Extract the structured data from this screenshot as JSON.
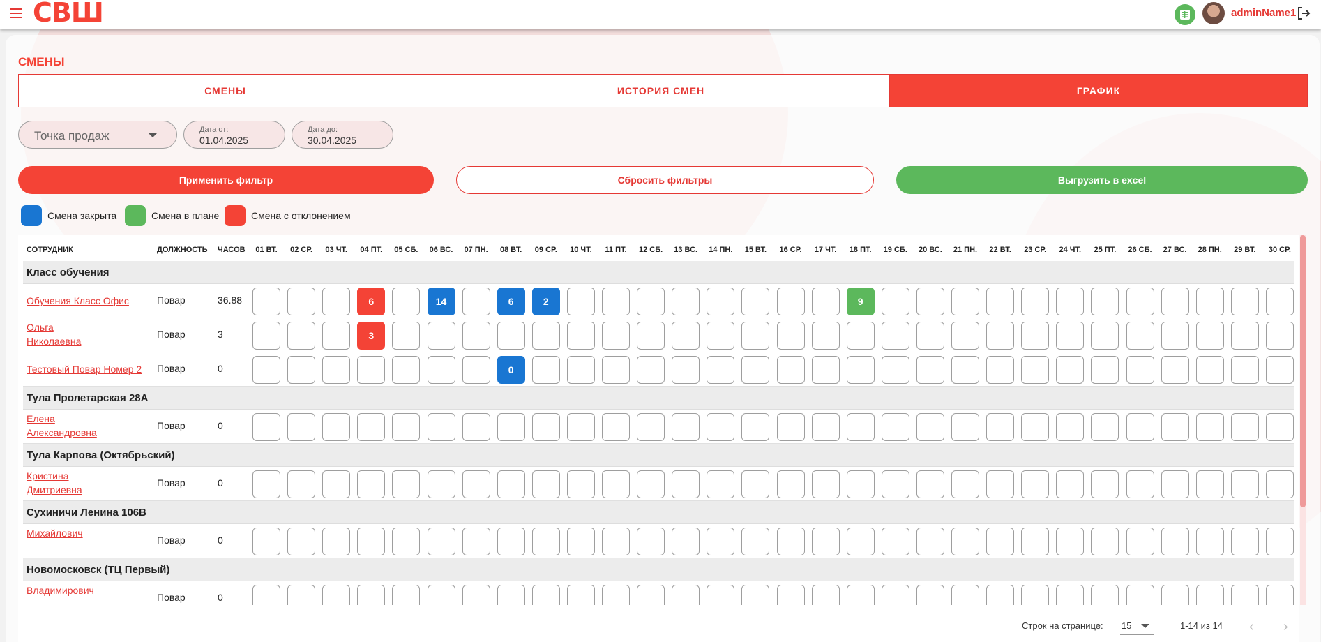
{
  "header": {
    "logo": "СВШ",
    "username": "adminName1",
    "icons": [
      "menu-icon",
      "excel-icon",
      "avatar",
      "logout-icon"
    ]
  },
  "page": {
    "title": "СМЕНЫ",
    "tabs": [
      {
        "label": "СМЕНЫ",
        "active": false
      },
      {
        "label": "ИСТОРИЯ СМЕН",
        "active": false
      },
      {
        "label": "ГРАФИК",
        "active": true
      }
    ]
  },
  "filters": {
    "point_placeholder": "Точка продаж",
    "date_from_label": "Дата от:",
    "date_from_value": "01.04.2025",
    "date_to_label": "Дата до:",
    "date_to_value": "30.04.2025"
  },
  "actions": {
    "apply": "Применить фильтр",
    "reset": "Сбросить фильтры",
    "export": "Выгрузить в excel"
  },
  "legend": [
    {
      "label": "Смена закрыта",
      "color": "#1976d2"
    },
    {
      "label": "Смена в плане",
      "color": "#5cb85c"
    },
    {
      "label": "Смена с отклонением",
      "color": "#f44336"
    }
  ],
  "table": {
    "columns": {
      "employee": "СОТРУДНИК",
      "position": "ДОЛЖНОСТЬ",
      "hours": "ЧАСОВ"
    },
    "days": [
      "01 ВТ.",
      "02 СР.",
      "03 ЧТ.",
      "04 ПТ.",
      "05 СБ.",
      "06 ВС.",
      "07 ПН.",
      "08 ВТ.",
      "09 СР.",
      "10 ЧТ.",
      "11 ПТ.",
      "12 СБ.",
      "13 ВС.",
      "14 ПН.",
      "15 ВТ.",
      "16 СР.",
      "17 ЧТ.",
      "18 ПТ.",
      "19 СБ.",
      "20 ВС.",
      "21 ПН.",
      "22 ВТ.",
      "23 СР.",
      "24 ЧТ.",
      "25 ПТ.",
      "26 СБ.",
      "27 ВС.",
      "28 ПН.",
      "29 ВТ.",
      "30 СР."
    ],
    "groups": [
      {
        "name": "Класс обучения",
        "rows": [
          {
            "employee": [
              "Обучения Класс Офис"
            ],
            "position": "Повар",
            "hours": "36.88",
            "shifts": [
              {
                "day": 4,
                "value": "6",
                "status": "red"
              },
              {
                "day": 6,
                "value": "14",
                "status": "blue"
              },
              {
                "day": 8,
                "value": "6",
                "status": "blue"
              },
              {
                "day": 9,
                "value": "2",
                "status": "blue"
              },
              {
                "day": 18,
                "value": "9",
                "status": "green"
              }
            ]
          },
          {
            "employee": [
              "Ольга",
              "Николаевна"
            ],
            "position": "Повар",
            "hours": "3",
            "shifts": [
              {
                "day": 4,
                "value": "3",
                "status": "red"
              }
            ]
          },
          {
            "employee": [
              "Тестовый Повар Номер 2"
            ],
            "position": "Повар",
            "hours": "0",
            "shifts": [
              {
                "day": 8,
                "value": "0",
                "status": "blue"
              }
            ]
          }
        ]
      },
      {
        "name": "Тула Пролетарская 28А",
        "rows": [
          {
            "employee": [
              "Елена",
              "Александровна"
            ],
            "position": "Повар",
            "hours": "0",
            "shifts": []
          }
        ]
      },
      {
        "name": "Тула Карпова (Октябрьский)",
        "rows": [
          {
            "employee": [
              "Кристина",
              "Дмитриевна"
            ],
            "position": "Повар",
            "hours": "0",
            "shifts": []
          }
        ]
      },
      {
        "name": "Сухиничи Ленина 106В",
        "rows": [
          {
            "employee": [
              "",
              "Михайлович"
            ],
            "position": "Повар",
            "hours": "0",
            "shifts": []
          }
        ]
      },
      {
        "name": "Новомосковск (ТЦ Первый)",
        "rows": [
          {
            "employee": [
              "",
              "Владимирович"
            ],
            "position": "Повар",
            "hours": "0",
            "shifts": []
          }
        ]
      }
    ]
  },
  "footer": {
    "rows_per_page_label": "Строк на странице:",
    "rows_per_page_value": "15",
    "range": "1-14 из 14"
  }
}
